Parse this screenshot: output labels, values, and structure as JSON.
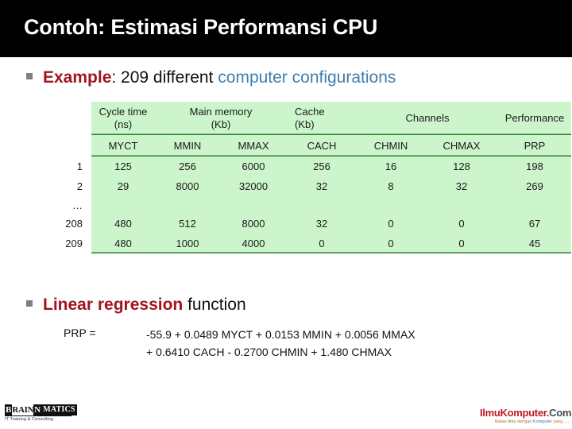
{
  "slide": {
    "title": "Contoh: Estimasi Performansi CPU",
    "title_bg": "#000000",
    "title_color": "#ffffff",
    "accent_red": "#a01520",
    "accent_blue": "#3f7fae",
    "table_fill": "#ccf5cc",
    "table_line": "#2f7d32"
  },
  "bullets": {
    "example": {
      "lead": "Example",
      "middle": ": 209 different ",
      "highlight": "computer configurations"
    },
    "linear": {
      "lead": "Linear regression",
      "rest": " function"
    }
  },
  "table": {
    "group_headers": [
      {
        "line1": "Cycle time",
        "line2": "(ns)"
      },
      {
        "line1": "Main memory",
        "line2": "(Kb)"
      },
      {
        "line1": "Cache",
        "line2": "(Kb)"
      },
      {
        "line1": "Channels",
        "line2": ""
      },
      {
        "line1": "Performance",
        "line2": ""
      }
    ],
    "abbr_headers": [
      "MYCT",
      "MMIN",
      "MMAX",
      "CACH",
      "CHMIN",
      "CHMAX",
      "PRP"
    ],
    "rows": [
      {
        "label": "1",
        "values": [
          "125",
          "256",
          "6000",
          "256",
          "16",
          "128",
          "198"
        ]
      },
      {
        "label": "2",
        "values": [
          "29",
          "8000",
          "32000",
          "32",
          "8",
          "32",
          "269"
        ]
      },
      {
        "label": "…",
        "values": [
          "",
          "",
          "",
          "",
          "",
          "",
          ""
        ]
      },
      {
        "label": "208",
        "values": [
          "480",
          "512",
          "8000",
          "32",
          "0",
          "0",
          "67"
        ]
      },
      {
        "label": "209",
        "values": [
          "480",
          "1000",
          "4000",
          "0",
          "0",
          "0",
          "45"
        ]
      }
    ]
  },
  "formula": {
    "lhs": "PRP =",
    "line1": "-55.9 + 0.0489 MYCT + 0.0153 MMIN + 0.0056 MMAX",
    "line2": "+ 0.6410 CACH - 0.2700 CHMIN + 1.480 CHMAX"
  },
  "footer": {
    "brainmatics": {
      "b": "B",
      "rain": "RAIN",
      "n": "N",
      "matics": "MATICS",
      "tagline": "IT Training & Consulting"
    },
    "ilmukomputer": {
      "name_red": "IlmuKomputer",
      "name_dark": ".Com",
      "tagline_1": "Ikatan ",
      "tagline_2": "Ilmu",
      "tagline_3": " dengan ",
      "tagline_4": "Komputer",
      "tagline_5": " yang ...."
    }
  }
}
